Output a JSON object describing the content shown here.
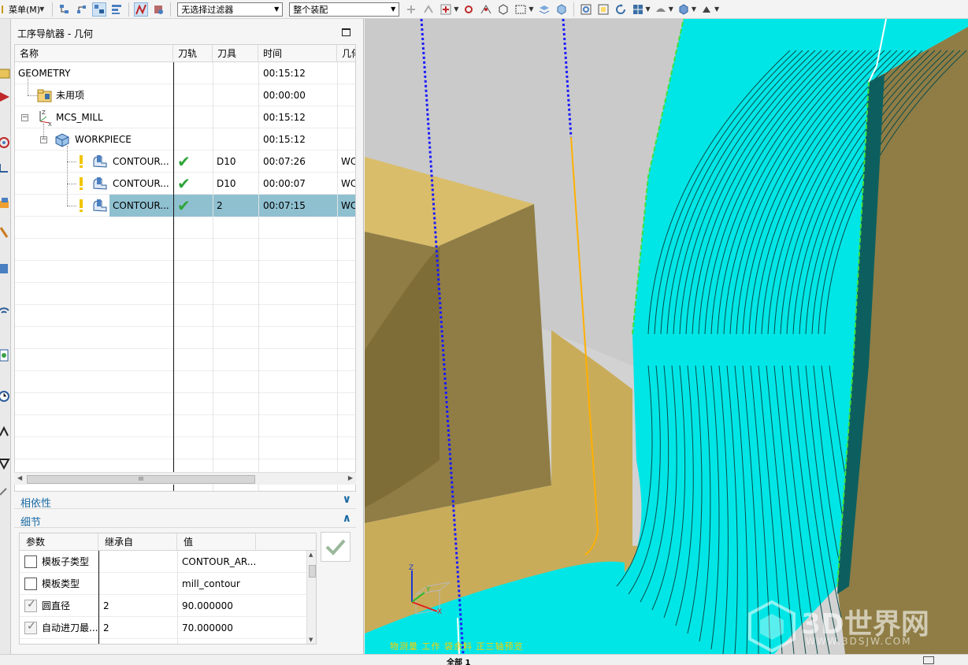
{
  "toolbar": {
    "menu_label": "菜单(M)",
    "filter_select": "无选择过滤器",
    "assembly_select": "整个装配"
  },
  "navigator": {
    "title": "工序导航器 - 几何",
    "columns": [
      "名称",
      "刀轨",
      "刀具",
      "时间",
      "几何"
    ],
    "rows": [
      {
        "name": "GEOMETRY",
        "toolpath": "",
        "tool": "",
        "time": "00:15:12",
        "geom": "",
        "icon": "none"
      },
      {
        "name": "未用项",
        "toolpath": "",
        "tool": "",
        "time": "00:00:00",
        "geom": "",
        "icon": "folder-icon"
      },
      {
        "name": "MCS_MILL",
        "toolpath": "",
        "tool": "",
        "time": "00:15:12",
        "geom": "",
        "icon": "mcs-icon"
      },
      {
        "name": "WORKPIECE",
        "toolpath": "",
        "tool": "",
        "time": "00:15:12",
        "geom": "",
        "icon": "workpiece-icon"
      },
      {
        "name": "CONTOUR...",
        "toolpath": "✔",
        "tool": "D10",
        "time": "00:07:26",
        "geom": "WC",
        "icon": "operation-icon"
      },
      {
        "name": "CONTOUR...",
        "toolpath": "✔",
        "tool": "D10",
        "time": "00:00:07",
        "geom": "WC",
        "icon": "operation-icon"
      },
      {
        "name": "CONTOUR...",
        "toolpath": "✔",
        "tool": "2",
        "time": "00:07:15",
        "geom": "WC",
        "icon": "operation-icon"
      }
    ],
    "selected_row": 6,
    "scroll_grip": "III"
  },
  "dependencies": {
    "label": "相依性"
  },
  "details": {
    "label": "细节",
    "columns": [
      "参数",
      "继承自",
      "值"
    ],
    "rows": [
      {
        "param": "模板子类型",
        "inherited": "",
        "value": "CONTOUR_AR...",
        "checked": false
      },
      {
        "param": "模板类型",
        "inherited": "",
        "value": "mill_contour",
        "checked": false
      },
      {
        "param": "圆直径",
        "inherited": "2",
        "value": "90.000000",
        "checked": true
      },
      {
        "param": "自动进刀最...",
        "inherited": "2",
        "value": "70.000000",
        "checked": true
      }
    ]
  },
  "viewport": {
    "prefilter_text": "物测量 工作 袋余料 正三轴预览",
    "watermark_text": "3D世界网",
    "watermark_url": "WWW.3DSJW.COM",
    "triad_labels": {
      "x": "X",
      "y": "Y",
      "z": "Z"
    }
  },
  "status": {
    "text": "全部 1"
  },
  "colors": {
    "toolpath_cyan": "#00e6e6",
    "part_tan": "#c9ac5a",
    "selection_blue": "#8fc0d0",
    "section_label_blue": "#1a6aa3"
  }
}
